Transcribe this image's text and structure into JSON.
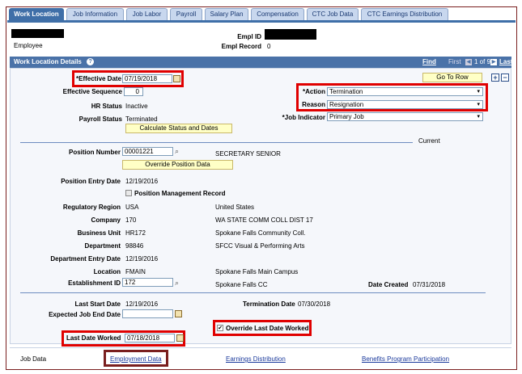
{
  "tabs": [
    {
      "label": "Work Location",
      "active": true
    },
    {
      "label": "Job Information"
    },
    {
      "label": "Job Labor"
    },
    {
      "label": "Payroll"
    },
    {
      "label": "Salary Plan"
    },
    {
      "label": "Compensation"
    },
    {
      "label": "CTC Job Data"
    },
    {
      "label": "CTC Earnings Distribution"
    }
  ],
  "header": {
    "employee_label": "Employee",
    "empl_id_label": "Empl ID",
    "empl_record_label": "Empl Record",
    "empl_record_value": "0"
  },
  "section": {
    "title": "Work Location Details",
    "find": "Find",
    "first": "First",
    "count": "1 of 9",
    "last": "Last",
    "go_to_row": "Go To Row"
  },
  "fields": {
    "effective_date_label": "*Effective Date",
    "effective_date": "07/19/2018",
    "effective_sequence_label": "Effective Sequence",
    "effective_sequence": "0",
    "hr_status_label": "HR Status",
    "hr_status": "Inactive",
    "payroll_status_label": "Payroll Status",
    "payroll_status": "Terminated",
    "calc_button": "Calculate Status and Dates",
    "action_label": "*Action",
    "action": "Termination",
    "reason_label": "Reason",
    "reason": "Resignation",
    "job_indicator_label": "*Job Indicator",
    "job_indicator": "Primary Job",
    "current": "Current",
    "position_number_label": "Position Number",
    "position_number": "00001221",
    "position_desc": "SECRETARY SENIOR",
    "override_position_button": "Override Position Data",
    "position_entry_label": "Position Entry Date",
    "position_entry": "12/19/2016",
    "pos_mgmt_record": "Position Management Record",
    "regulatory_region_label": "Regulatory Region",
    "regulatory_region": "USA",
    "regulatory_region_desc": "United States",
    "company_label": "Company",
    "company": "170",
    "company_desc": "WA STATE COMM COLL DIST 17",
    "business_unit_label": "Business Unit",
    "business_unit": "HR172",
    "business_unit_desc": "Spokane Falls Community Coll.",
    "department_label": "Department",
    "department": "98846",
    "department_desc": "SFCC Visual & Performing Arts",
    "dept_entry_label": "Department Entry Date",
    "dept_entry": "12/19/2016",
    "location_label": "Location",
    "location": "FMAIN",
    "location_desc": "Spokane Falls Main Campus",
    "establishment_label": "Establishment ID",
    "establishment": "172",
    "establishment_desc": "Spokane Falls CC",
    "date_created_label": "Date Created",
    "date_created": "07/31/2018",
    "last_start_label": "Last Start Date",
    "last_start": "12/19/2016",
    "termination_label": "Termination Date",
    "termination": "07/30/2018",
    "expected_end_label": "Expected Job End Date",
    "expected_end": "",
    "override_last_date": "Override Last Date Worked",
    "last_date_worked_label": "Last Date Worked",
    "last_date_worked": "07/18/2018"
  },
  "footer": {
    "job_data": "Job Data",
    "employment_data": "Employment Data",
    "earnings_distribution": "Earnings Distribution",
    "benefits": "Benefits Program Participation"
  }
}
